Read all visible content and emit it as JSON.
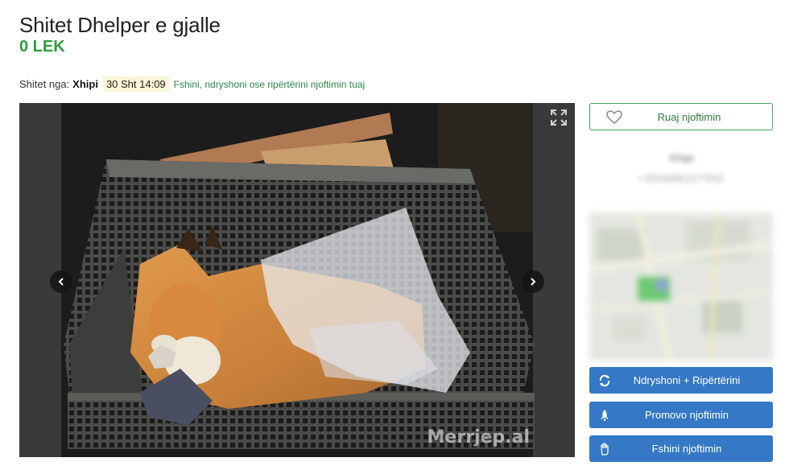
{
  "listing": {
    "title": "Shitet Dhelper e gjalle",
    "price": "0 LEK"
  },
  "meta": {
    "sold_by_label": "Shitet nga:",
    "seller": "Xhipi",
    "date": "30 Sht 14:09",
    "manage_link": "Fshini, ndryshoni ose ripërtërini njoftimin tuaj"
  },
  "gallery": {
    "watermark": "Merrjep.al",
    "icons": [
      "expand-icon",
      "chevron-left-icon",
      "chevron-right-icon"
    ]
  },
  "sidebar": {
    "save_label": "Ruaj njoftimin",
    "contact_name": "Xhipi",
    "contact_phone": "+355686227552",
    "actions": [
      {
        "label": "Ndryshoni + Ripërtërini",
        "icon": "refresh-icon"
      },
      {
        "label": "Promovo njoftimin",
        "icon": "rocket-icon"
      },
      {
        "label": "Fshini njoftimin",
        "icon": "hand-icon"
      }
    ]
  },
  "colors": {
    "price_green": "#2e9e3e",
    "link_green": "#2a8a4a",
    "action_blue": "#3478c6",
    "date_highlight": "#fdf3d7"
  }
}
